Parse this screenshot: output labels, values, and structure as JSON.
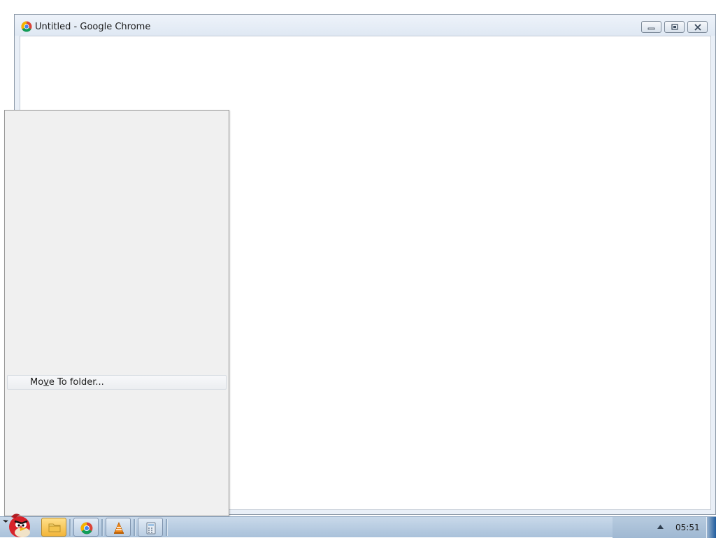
{
  "window": {
    "title": "Untitled - Google Chrome",
    "icon": "chrome-icon",
    "controls": [
      "minimize-icon",
      "restore-icon",
      "close-icon"
    ]
  },
  "context_menu": {
    "items": [
      {
        "label_pre": "Mo",
        "mnemonic": "v",
        "label_post": "e To folder..."
      }
    ]
  },
  "taskbar": {
    "start_icon": "angry-bird-start-icon",
    "apps": [
      {
        "name": "folder-icon",
        "active": true
      },
      {
        "name": "chrome-icon",
        "active": false
      },
      {
        "name": "vlc-icon",
        "active": false
      },
      {
        "name": "calculator-icon",
        "active": false
      }
    ],
    "clock": "05:51"
  },
  "colors": {
    "menu_bg": "#f0f0f0",
    "taskbar": "#b9cde2",
    "active_button": "#f2b53a"
  }
}
